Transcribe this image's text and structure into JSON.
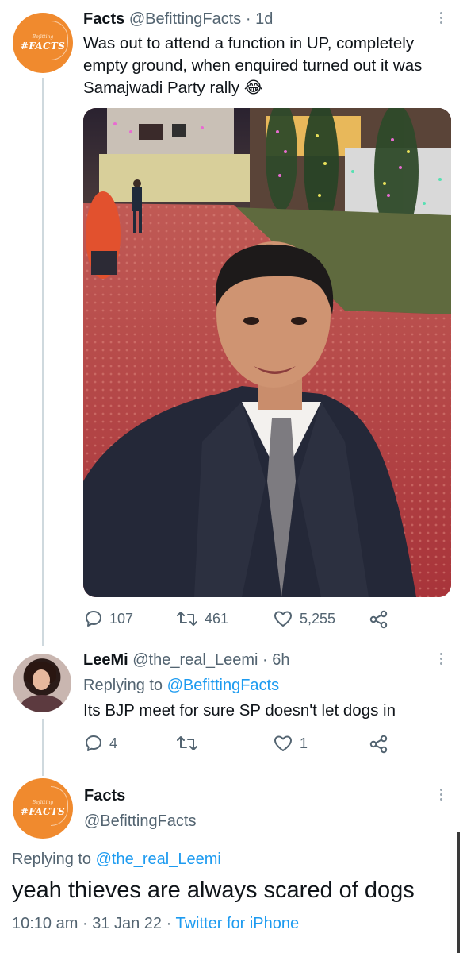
{
  "tweet": {
    "author_name": "Facts",
    "author_handle": "@BefittingFacts",
    "age": "1d",
    "text_lines": [
      "Was out to attend a function in UP, completely",
      "empty ground, when enquired turned out it was",
      "Samajwadi Party rally 😂"
    ],
    "avatar_small_text": "Befitting",
    "avatar_logo_text": "#FACTS",
    "replies": "107",
    "retweets": "461",
    "likes": "5,255"
  },
  "reply1": {
    "author_name": "LeeMi",
    "author_handle": "@the_real_Leemi",
    "age": "6h",
    "replying_to_prefix": "Replying to",
    "replying_to_handle": "@BefittingFacts",
    "text": "Its BJP meet for sure SP doesn't let dogs in",
    "replies": "4",
    "retweets": "",
    "likes": "1"
  },
  "focus": {
    "author_name": "Facts",
    "author_handle": "@BefittingFacts",
    "avatar_small_text": "Befitting",
    "avatar_logo_text": "#FACTS",
    "replying_to_prefix": "Replying to",
    "replying_to_handle": "@the_real_Leemi",
    "text": "yeah thieves are always scared of dogs",
    "time": "10:10 am",
    "date": "31 Jan 22",
    "client": "Twitter for iPhone"
  },
  "colors": {
    "accent": "#1d9bf0",
    "muted": "#536471",
    "facts_orange": "#f08a2e"
  }
}
